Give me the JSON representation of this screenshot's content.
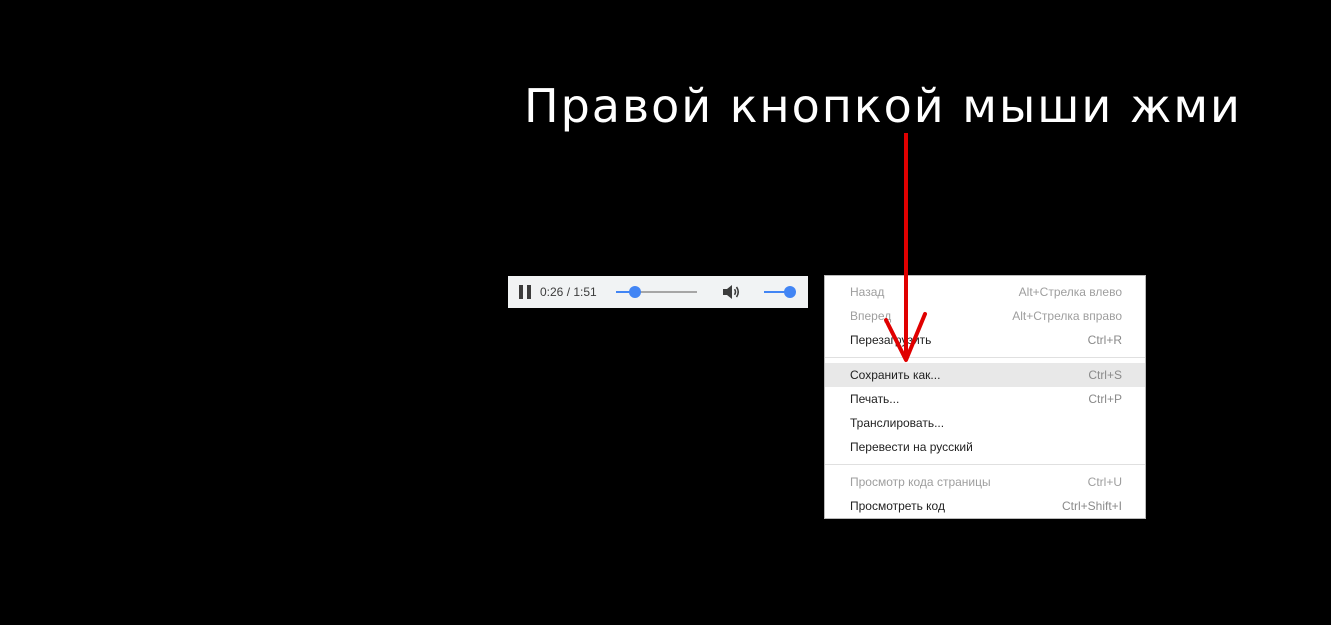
{
  "instruction": {
    "text": "Правой кнопкой мыши жми"
  },
  "player": {
    "state": "playing",
    "current_time": "0:26",
    "duration": "1:51",
    "time_text": "0:26 / 1:51",
    "progress_fraction": 0.234,
    "volume_fraction": 1.0,
    "icons": {
      "play_pause": "pause-icon",
      "volume": "volume-icon"
    },
    "colors": {
      "background": "#f1f3f4",
      "accent": "#4285f4"
    }
  },
  "context_menu": {
    "groups": [
      [
        {
          "label": "Назад",
          "shortcut": "Alt+Стрелка влево",
          "disabled": true
        },
        {
          "label": "Вперед",
          "shortcut": "Alt+Стрелка вправо",
          "disabled": true
        },
        {
          "label": "Перезагрузить",
          "shortcut": "Ctrl+R",
          "disabled": false
        }
      ],
      [
        {
          "label": "Сохранить как...",
          "shortcut": "Ctrl+S",
          "disabled": false,
          "highlighted": true
        },
        {
          "label": "Печать...",
          "shortcut": "Ctrl+P",
          "disabled": false
        },
        {
          "label": "Транслировать...",
          "shortcut": "",
          "disabled": false
        },
        {
          "label": "Перевести на русский",
          "shortcut": "",
          "disabled": false
        }
      ],
      [
        {
          "label": "Просмотр кода страницы",
          "shortcut": "Ctrl+U",
          "disabled": true
        },
        {
          "label": "Просмотреть код",
          "shortcut": "Ctrl+Shift+I",
          "disabled": false
        }
      ]
    ]
  },
  "annotation": {
    "arrow_color": "#e00000",
    "points_to": "Сохранить как..."
  }
}
